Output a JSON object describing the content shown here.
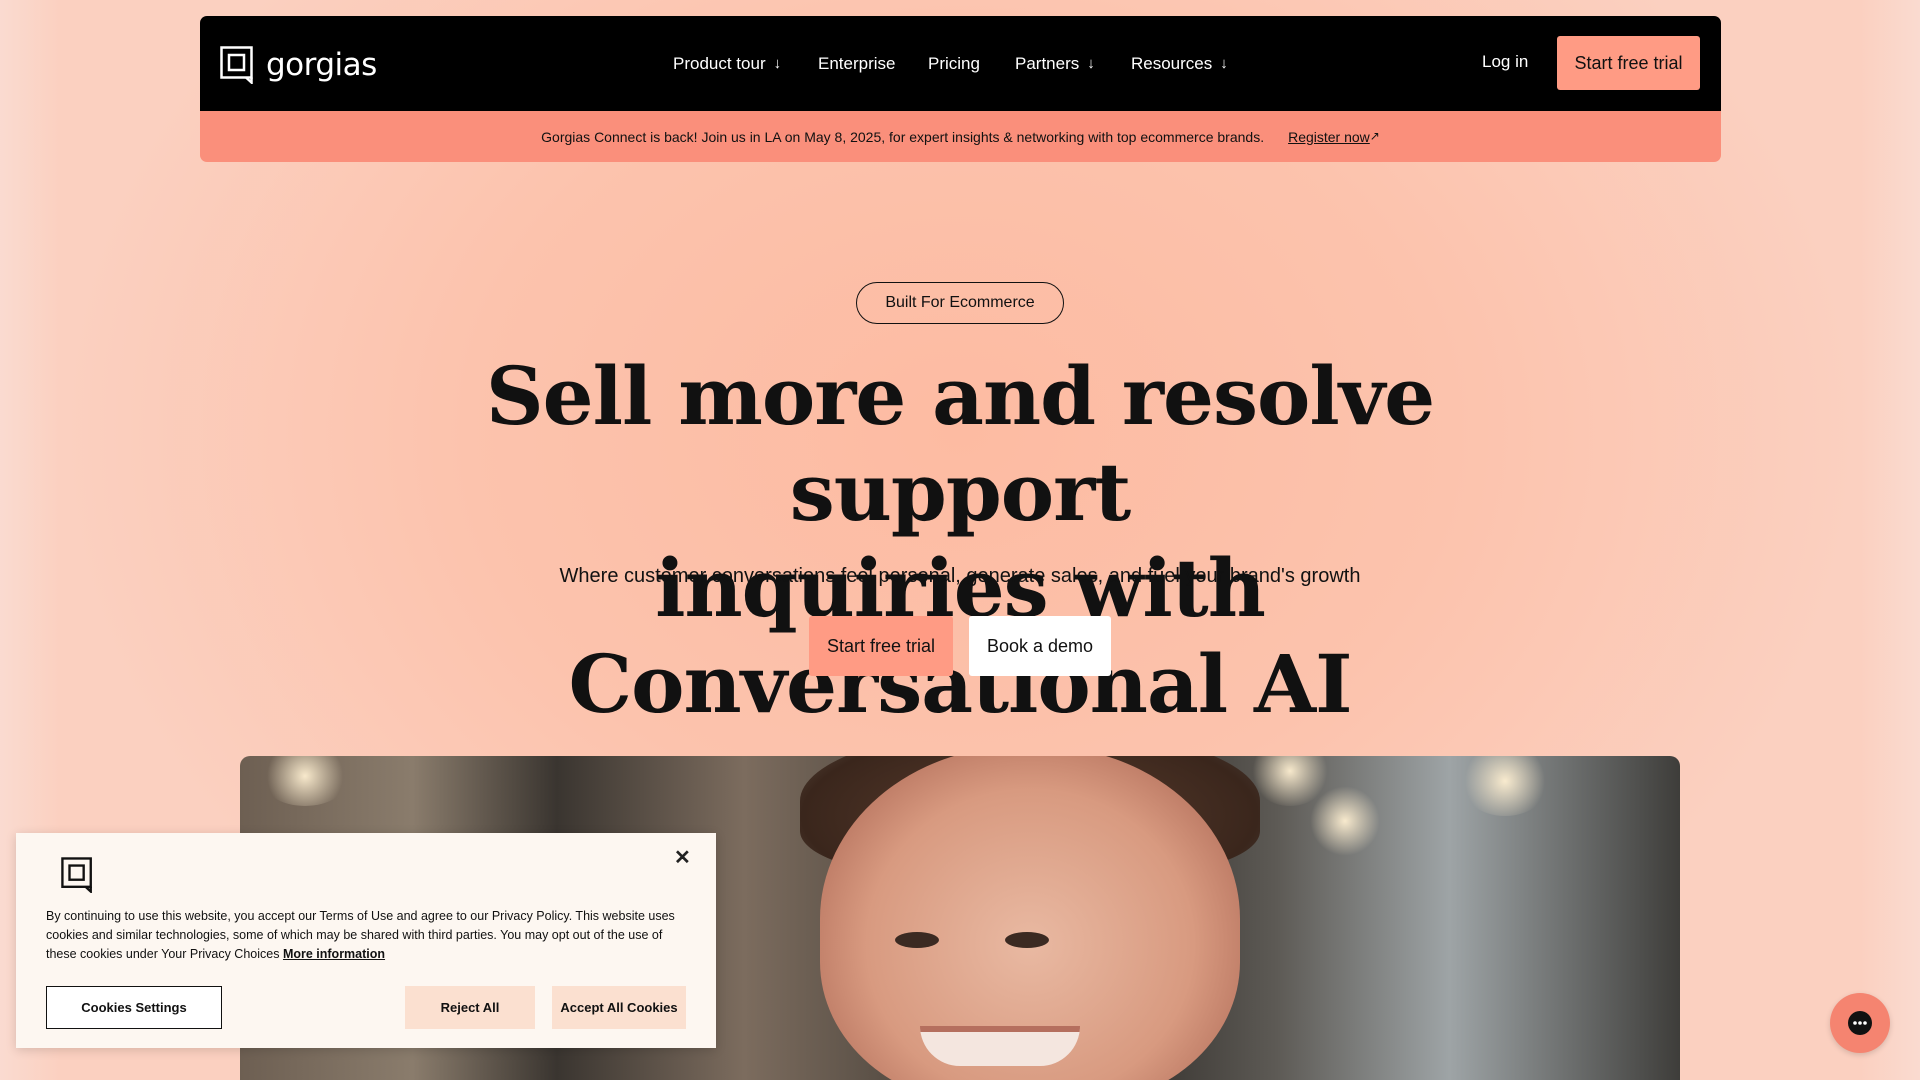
{
  "header": {
    "logo_text": "gorgias",
    "nav": [
      {
        "label": "Product tour",
        "arrow": "↓"
      },
      {
        "label": "Enterprise",
        "arrow": ""
      },
      {
        "label": "Pricing",
        "arrow": ""
      },
      {
        "label": "Partners",
        "arrow": "↓"
      },
      {
        "label": "Resources",
        "arrow": "↓"
      }
    ],
    "login_label": "Log in",
    "trial_label": "Start free trial"
  },
  "announcement": {
    "text": "Gorgias Connect is back! Join us in LA on May 8, 2025, for expert insights & networking with top ecommerce brands.",
    "link_label": "Register now",
    "link_icon": "↗"
  },
  "hero": {
    "pill": "Built For Ecommerce",
    "headline_line1": "Sell more and resolve support",
    "headline_line2": "inquiries with Conversational AI",
    "subtitle": "Where customer conversations feel personal, generate sales, and fuel your brand's growth",
    "primary_cta": "Start free trial",
    "secondary_cta": "Book a demo"
  },
  "cookie": {
    "text": "By continuing to use this website, you accept our Terms of Use and agree to our Privacy Policy. This website uses cookies and similar technologies, some of which may be shared with third parties. You may opt out of the use of these cookies under Your Privacy Choices",
    "more_label": "More information",
    "close_icon": "✕",
    "settings_label": "Cookies Settings",
    "reject_label": "Reject All",
    "accept_label": "Accept All Cookies"
  },
  "colors": {
    "accent": "#ff9b84",
    "banner": "#fa8f7b",
    "background": "#fcc1aa",
    "header": "#000000"
  }
}
